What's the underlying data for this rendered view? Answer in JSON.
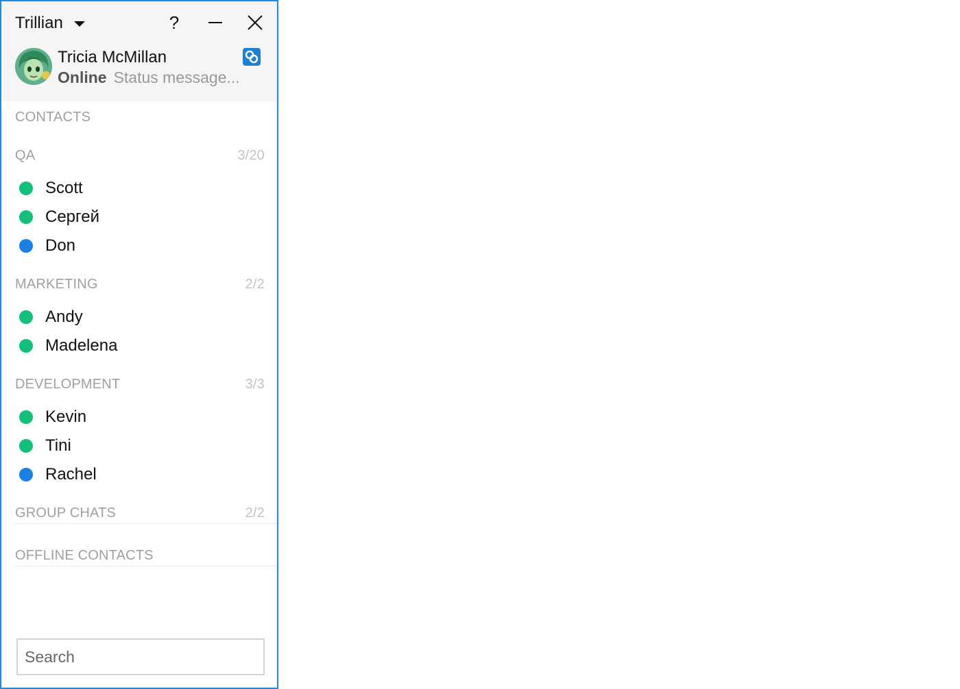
{
  "app": {
    "title": "Trillian"
  },
  "titlebar": {
    "help_label": "?"
  },
  "profile": {
    "name": "Tricia McMillan",
    "status": "Online",
    "status_message": "Status message..."
  },
  "contacts_header": "CONTACTS",
  "groups": [
    {
      "name": "QA",
      "count": "3/20",
      "contacts": [
        {
          "name": "Scott",
          "status": "green"
        },
        {
          "name": "Сергей",
          "status": "green"
        },
        {
          "name": "Don",
          "status": "blue"
        }
      ]
    },
    {
      "name": "MARKETING",
      "count": "2/2",
      "contacts": [
        {
          "name": "Andy",
          "status": "green"
        },
        {
          "name": "Madelena",
          "status": "green"
        }
      ]
    },
    {
      "name": "DEVELOPMENT",
      "count": "3/3",
      "contacts": [
        {
          "name": "Kevin",
          "status": "green"
        },
        {
          "name": "Tini",
          "status": "green"
        },
        {
          "name": "Rachel",
          "status": "blue"
        }
      ]
    }
  ],
  "group_chats": {
    "label": "GROUP CHATS",
    "count": "2/2"
  },
  "offline": {
    "label": "OFFLINE CONTACTS"
  },
  "search": {
    "placeholder": "Search"
  },
  "colors": {
    "accent": "#1e88e5",
    "online": "#12c07a",
    "away": "#1a7fe6"
  }
}
